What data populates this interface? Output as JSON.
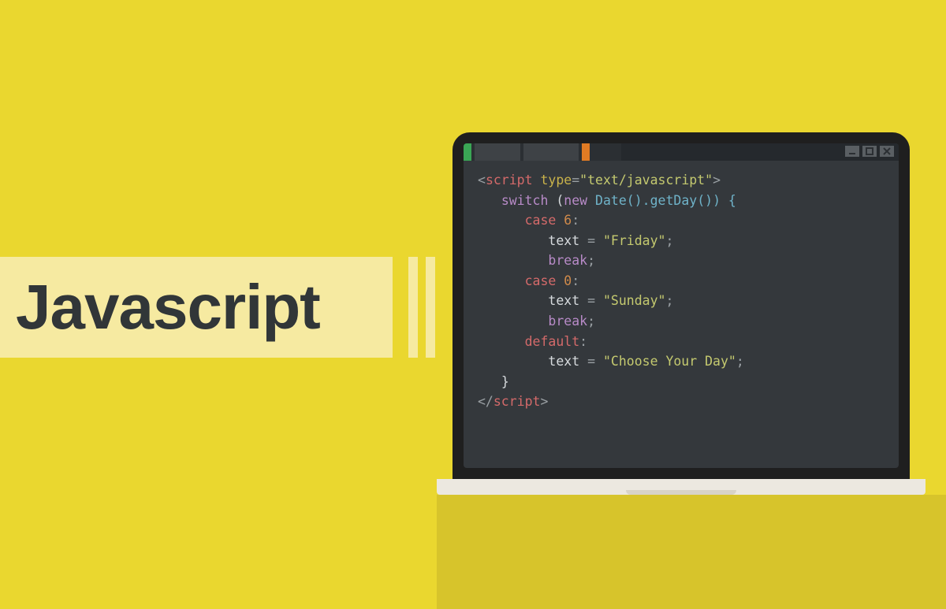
{
  "title": "Javascript",
  "window_controls": {
    "minimize": "minimize",
    "maximize": "maximize",
    "close": "close"
  },
  "code": {
    "line1": {
      "open": "<",
      "tag": "script",
      "space": " ",
      "attr": "type",
      "eq": "=",
      "q1": "\"",
      "val": "text/javascript",
      "q2": "\"",
      "close": ">"
    },
    "line2": {
      "kw": "switch",
      "sp": " (",
      "new": "new",
      "sp2": " ",
      "cls": "Date",
      "call": "().getDay()) {"
    },
    "line3": {
      "kw": "case",
      "sp": " ",
      "num": "6",
      "colon": ":"
    },
    "line4": {
      "lhs": "text",
      "eq": " = ",
      "q1": "\"",
      "val": "Friday",
      "q2": "\"",
      ";": ";"
    },
    "line5": {
      "kw": "break",
      ";": ";"
    },
    "line6": {
      "kw": "case",
      "sp": " ",
      "num": "0",
      "colon": ":"
    },
    "line7": {
      "lhs": "text",
      "eq": " = ",
      "q1": "\"",
      "val": "Sunday",
      "q2": "\"",
      ";": ";"
    },
    "line8": {
      "kw": "break",
      ";": ";"
    },
    "line9": {
      "kw": "default",
      "colon": ":"
    },
    "line10": {
      "lhs": "text",
      "eq": " = ",
      "q1": "\"",
      "val": "Choose Your Day",
      "q2": "\"",
      ";": ";"
    },
    "line11": {
      "brace": "}"
    },
    "line12": {
      "open": "</",
      "tag": "script",
      "close": ">"
    }
  }
}
